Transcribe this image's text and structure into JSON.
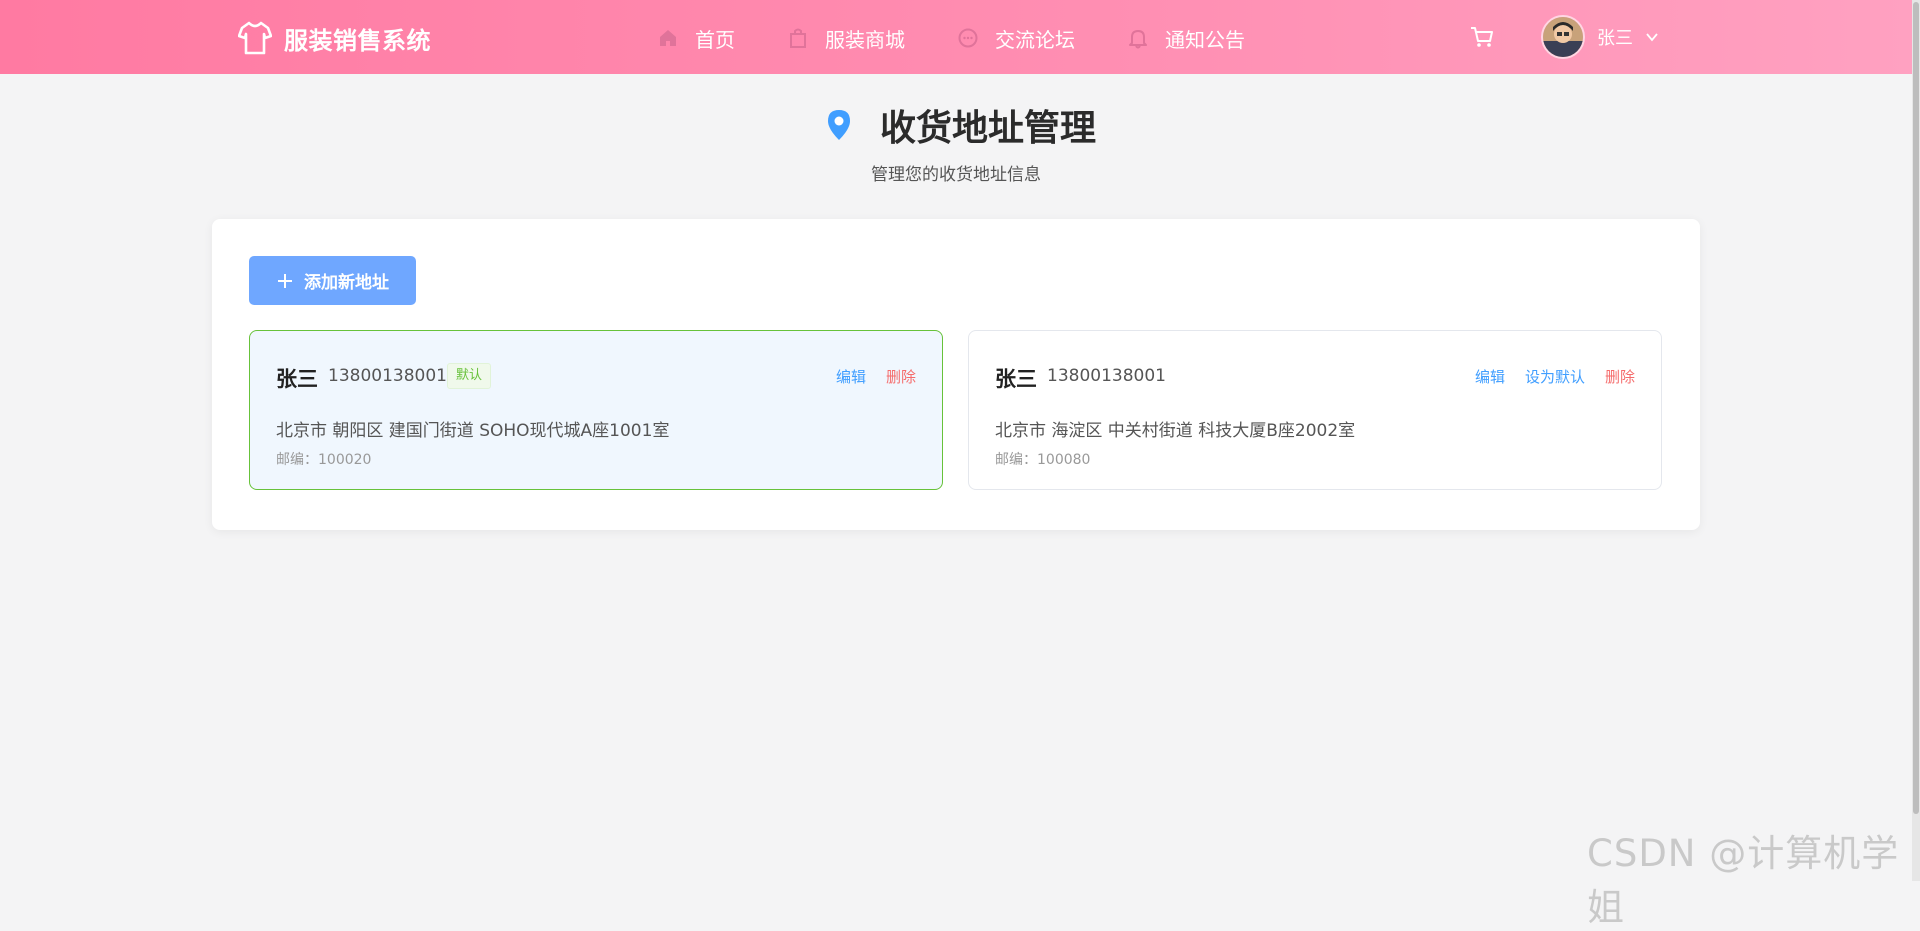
{
  "header": {
    "brand": "服装销售系统",
    "nav": [
      {
        "label": "首页",
        "icon": "home-icon"
      },
      {
        "label": "服装商城",
        "icon": "shopping-bag-icon"
      },
      {
        "label": "交流论坛",
        "icon": "chat-bubble-icon"
      },
      {
        "label": "通知公告",
        "icon": "bell-icon"
      }
    ],
    "user": {
      "name": "张三"
    }
  },
  "page": {
    "title": "收货地址管理",
    "subtitle": "管理您的收货地址信息"
  },
  "toolbar": {
    "add_label": "添加新地址"
  },
  "addresses": [
    {
      "name": "张三",
      "phone": "13800138001",
      "badge": "默认",
      "actions": {
        "edit": "编辑",
        "delete": "删除"
      },
      "address": "北京市 朝阳区 建国门街道 SOHO现代城A座1001室",
      "zip": "邮编：100020"
    },
    {
      "name": "张三",
      "phone": "13800138001",
      "actions": {
        "edit": "编辑",
        "set_default": "设为默认",
        "delete": "删除"
      },
      "address": "北京市 海淀区 中关村街道 科技大厦B座2002室",
      "zip": "邮编：100080"
    }
  ],
  "watermark": "CSDN @计算机学姐",
  "colors": {
    "header_start": "#ff7aa2",
    "header_end": "#ffa1c1",
    "primary": "#409eff",
    "danger": "#f56c6c",
    "success": "#67c23a",
    "add_button": "#6fa7ff"
  }
}
